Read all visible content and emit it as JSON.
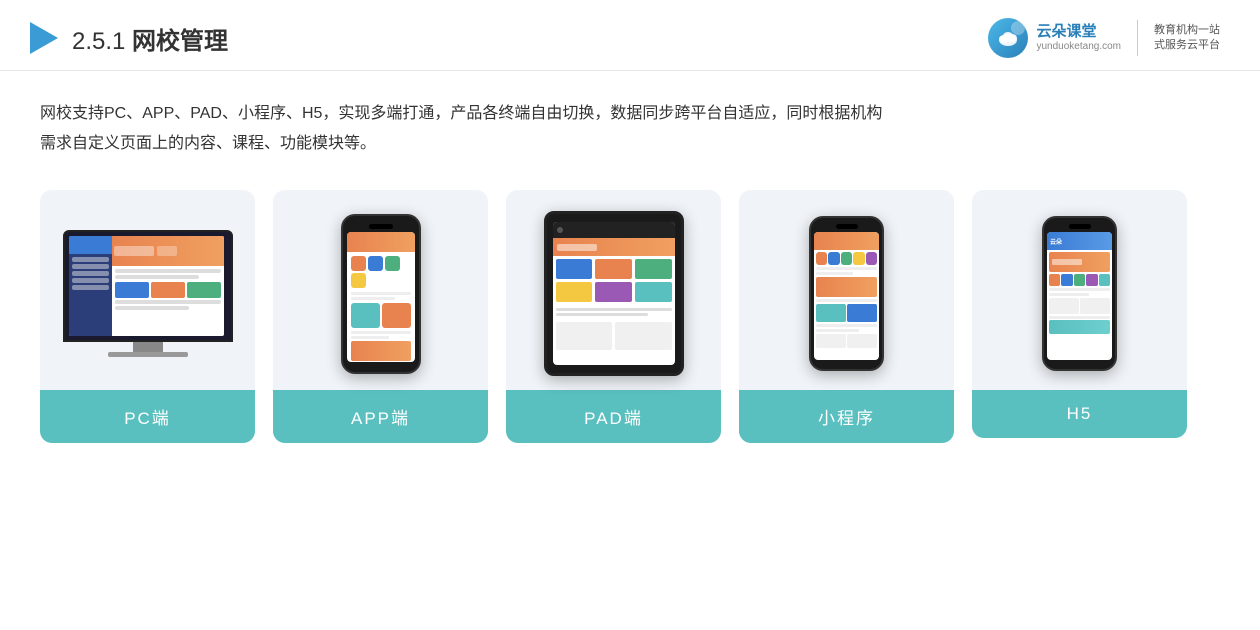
{
  "header": {
    "section_number": "2.5.1",
    "title_regular": "",
    "title_bold": "网校管理",
    "title_full": "2.5.1 网校管理"
  },
  "brand": {
    "name": "云朵课堂",
    "domain": "yunduoketang.com",
    "slogan_line1": "教育机构一站",
    "slogan_line2": "式服务云平台"
  },
  "description": {
    "line1": "网校支持PC、APP、PAD、小程序、H5，实现多端打通，产品各终端自由切换，数据同步跨平台自适应，同时根据机构",
    "line2": "需求自定义页面上的内容、课程、功能模块等。"
  },
  "cards": [
    {
      "id": "pc",
      "label": "PC端"
    },
    {
      "id": "app",
      "label": "APP端"
    },
    {
      "id": "pad",
      "label": "PAD端"
    },
    {
      "id": "mini",
      "label": "小程序"
    },
    {
      "id": "h5",
      "label": "H5"
    }
  ]
}
